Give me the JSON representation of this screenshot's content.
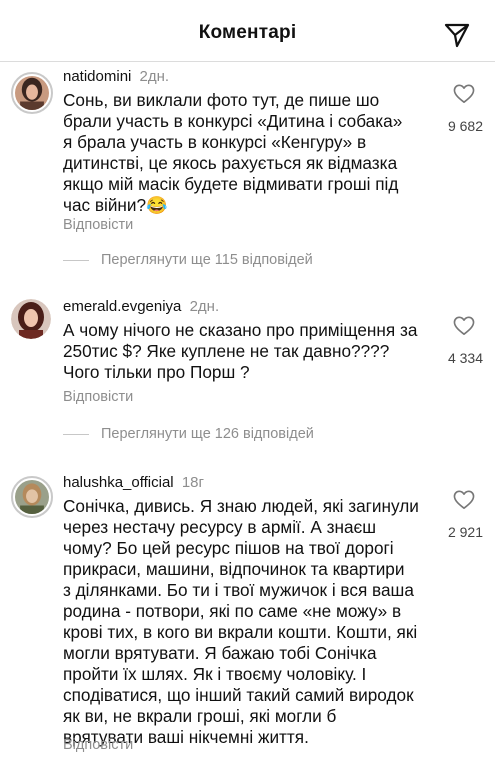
{
  "header": {
    "title": "Коментарі",
    "send_icon": "paper-plane-icon"
  },
  "comments": [
    {
      "username": "natidomini",
      "time": "2дн.",
      "text_lines": [
        "Сонь, ви виклали фото тут, де пише шо",
        "брали участь в конкурсі «Дитина і собака»",
        "я брала участь в конкурсі «Кенгуру» в",
        "дитинстві, це якось рахується як відмазка",
        "якщо мій масік будете відмивати гроші під",
        "час війни?😂"
      ],
      "reply_label": "Відповісти",
      "like_count": "9 682",
      "view_replies": "Переглянути ще 115 відповідей"
    },
    {
      "username": "emerald.evgeniya",
      "time": "2дн.",
      "text_lines": [
        "А чому нічого не сказано про приміщення за",
        "250тис $? Яке куплене не так давно????",
        "Чого тільки про Порш ?"
      ],
      "reply_label": "Відповісти",
      "like_count": "4 334",
      "view_replies": "Переглянути ще 126 відповідей"
    },
    {
      "username": "halushka_official",
      "time": "18г",
      "text_lines": [
        "Сонічка, дивись. Я знаю людей, які загинули",
        "через нестачу ресурсу в армії. А знаєш",
        "чому? Бо цей ресурс пішов на твої дорогі",
        "прикраси, машини, відпочинок та квартири",
        "з ділянками. Бо ти і твої мужичок і вся ваша",
        "родина - потвори, які по саме «не можу» в",
        "крові тих, в кого ви вкрали кошти. Кошти, які",
        "могли врятувати. Я бажаю тобі Сонічка",
        "пройти їх шлях. Як і твоєму чоловіку. І",
        "сподіватися, що інший такий самий виродок",
        "як ви, не вкрали гроші, які могли б",
        "врятувати ваші нікчемні життя."
      ],
      "reply_label": "Відповісти",
      "like_count": "2 921"
    }
  ]
}
